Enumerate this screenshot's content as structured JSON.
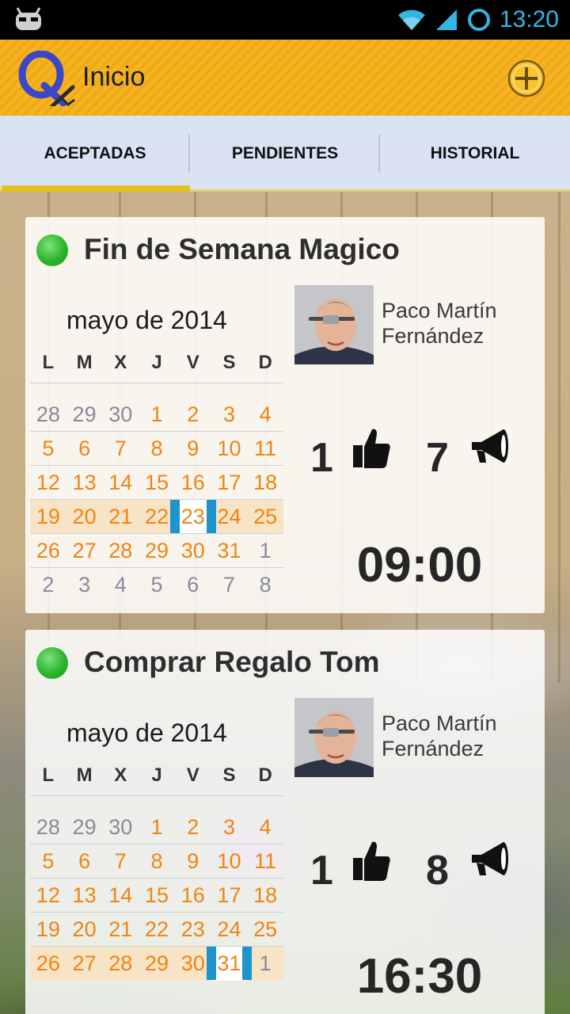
{
  "status_bar": {
    "time": "13:20",
    "icons": [
      "android-icon",
      "wifi-icon",
      "signal-icon",
      "sync-ring-icon"
    ]
  },
  "action_bar": {
    "title": "Inicio",
    "icons": [
      "app-logo-icon",
      "add-circle-icon"
    ]
  },
  "tabs": [
    {
      "label": "ACEPTADAS",
      "selected": true
    },
    {
      "label": "PENDIENTES",
      "selected": false
    },
    {
      "label": "HISTORIAL",
      "selected": false
    }
  ],
  "colors": {
    "accent_orange": "#f08410",
    "today_marker": "#1f93cc",
    "status_dot": "#2bb52b",
    "tab_indicator": "#e3c024"
  },
  "weekday_labels": [
    "L",
    "M",
    "X",
    "J",
    "V",
    "S",
    "D"
  ],
  "cards": [
    {
      "title": "Fin de Semana Magico",
      "status_icon": "green-dot-icon",
      "calendar": {
        "month": "mayo de 2014",
        "rows": [
          [
            "28",
            "29",
            "30",
            "1",
            "2",
            "3",
            "4"
          ],
          [
            "5",
            "6",
            "7",
            "8",
            "9",
            "10",
            "11"
          ],
          [
            "12",
            "13",
            "14",
            "15",
            "16",
            "17",
            "18"
          ],
          [
            "19",
            "20",
            "21",
            "22",
            "23",
            "24",
            "25"
          ],
          [
            "26",
            "27",
            "28",
            "29",
            "30",
            "31",
            "1"
          ],
          [
            "2",
            "3",
            "4",
            "5",
            "6",
            "7",
            "8"
          ]
        ],
        "highlighted_week": 3,
        "selected_day": "23"
      },
      "user": {
        "first_line": "Paco Martín",
        "second_line": "Fernández"
      },
      "likes": "1",
      "announcements": "7",
      "time": "09:00"
    },
    {
      "title": "Comprar Regalo Tom",
      "status_icon": "green-dot-icon",
      "calendar": {
        "month": "mayo de 2014",
        "rows": [
          [
            "28",
            "29",
            "30",
            "1",
            "2",
            "3",
            "4"
          ],
          [
            "5",
            "6",
            "7",
            "8",
            "9",
            "10",
            "11"
          ],
          [
            "12",
            "13",
            "14",
            "15",
            "16",
            "17",
            "18"
          ],
          [
            "19",
            "20",
            "21",
            "22",
            "23",
            "24",
            "25"
          ],
          [
            "26",
            "27",
            "28",
            "29",
            "30",
            "31",
            "1"
          ]
        ],
        "highlighted_week": 4,
        "selected_day": "31"
      },
      "user": {
        "first_line": "Paco Martín",
        "second_line": "Fernández"
      },
      "likes": "1",
      "announcements": "8",
      "time": "16:30"
    }
  ]
}
